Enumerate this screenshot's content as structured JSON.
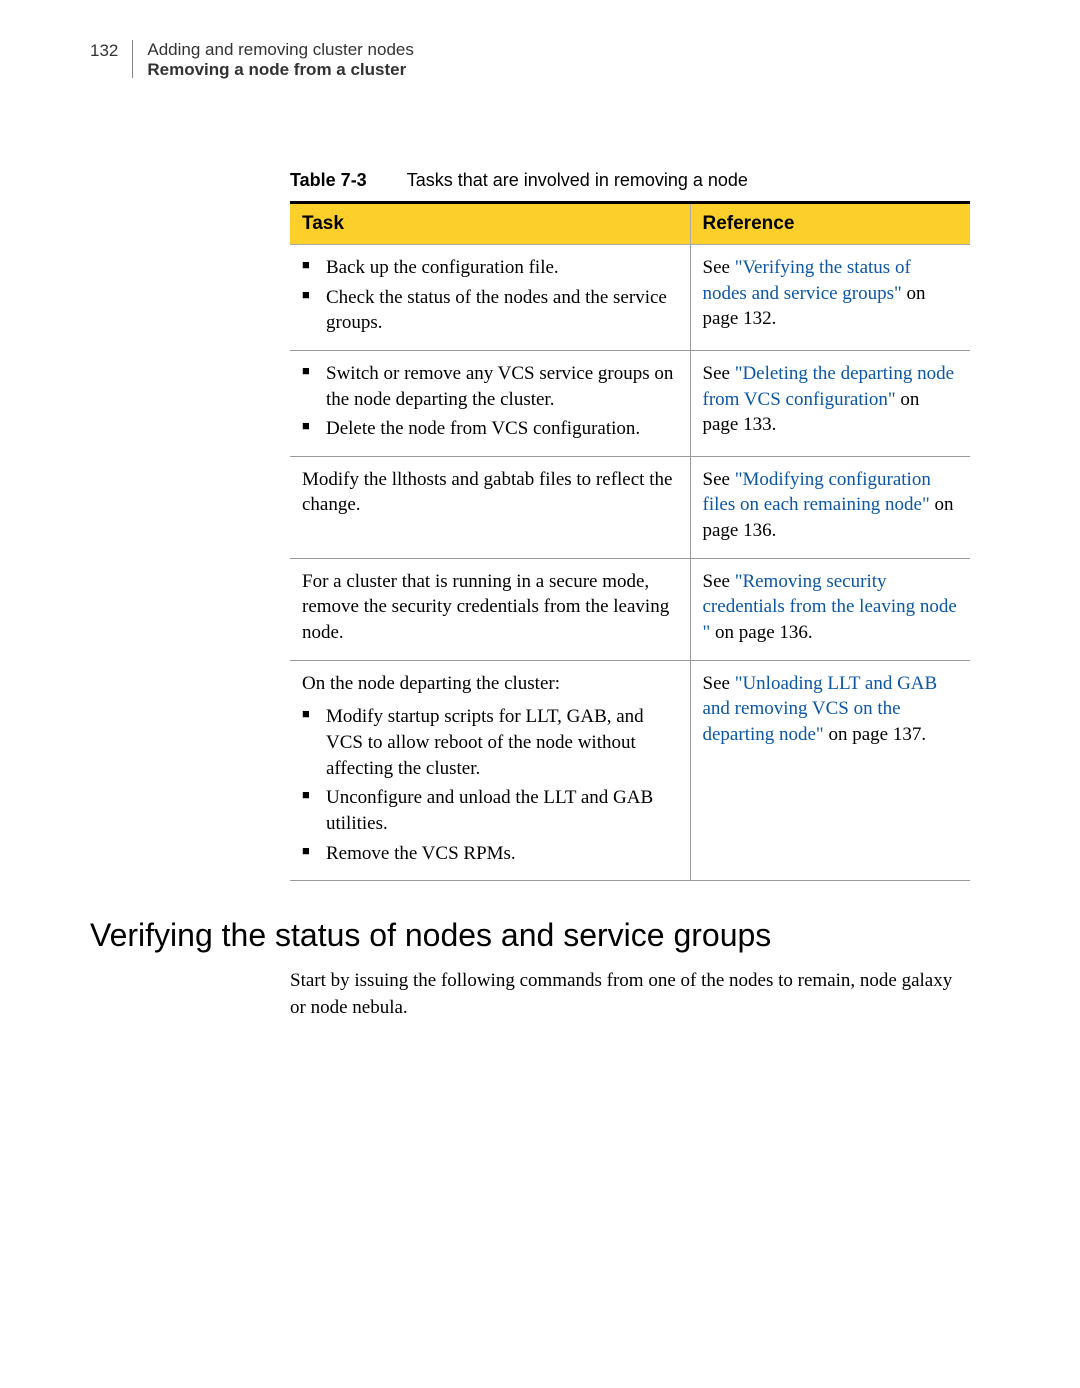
{
  "header": {
    "page_number": "132",
    "chapter": "Adding and removing cluster nodes",
    "section": "Removing a node from a cluster"
  },
  "table": {
    "caption_label": "Table 7-3",
    "caption_text": "Tasks that are involved in removing a node",
    "col_task": "Task",
    "col_ref": "Reference",
    "rows": [
      {
        "task_type": "bullets",
        "bullets": [
          "Back up the configuration file.",
          "Check the status of the nodes and the service groups."
        ],
        "ref_prefix": "See ",
        "ref_link": "\"Verifying the status of nodes and service groups\"",
        "ref_suffix": " on page 132."
      },
      {
        "task_type": "bullets",
        "bullets": [
          "Switch or remove any VCS service groups on the node departing the cluster.",
          "Delete the node from VCS configuration."
        ],
        "ref_prefix": "See ",
        "ref_link": "\"Deleting the departing node from VCS configuration\"",
        "ref_suffix": " on page 133."
      },
      {
        "task_type": "plain",
        "text": "Modify the llthosts and gabtab files to reflect the change.",
        "ref_prefix": "See ",
        "ref_link": "\"Modifying configuration files on each remaining node\"",
        "ref_suffix": " on page 136."
      },
      {
        "task_type": "plain",
        "text": "For a cluster that is running in a secure mode, remove the security credentials from the leaving node.",
        "ref_prefix": "See ",
        "ref_link": "\"Removing security credentials from the leaving node \"",
        "ref_suffix": " on page 136."
      },
      {
        "task_type": "lead_bullets",
        "lead": "On the node departing the cluster:",
        "bullets": [
          "Modify startup scripts for LLT, GAB, and VCS to allow reboot of the node without affecting the cluster.",
          "Unconfigure and unload the LLT and GAB utilities.",
          "Remove the VCS RPMs."
        ],
        "ref_prefix": "See ",
        "ref_link": "\"Unloading LLT and GAB and removing VCS on the departing node\"",
        "ref_suffix": " on page 137."
      }
    ]
  },
  "subsection_heading": "Verifying the status of nodes and service groups",
  "body_paragraph": "Start by issuing the following commands from one of the nodes to remain, node galaxy or node nebula."
}
